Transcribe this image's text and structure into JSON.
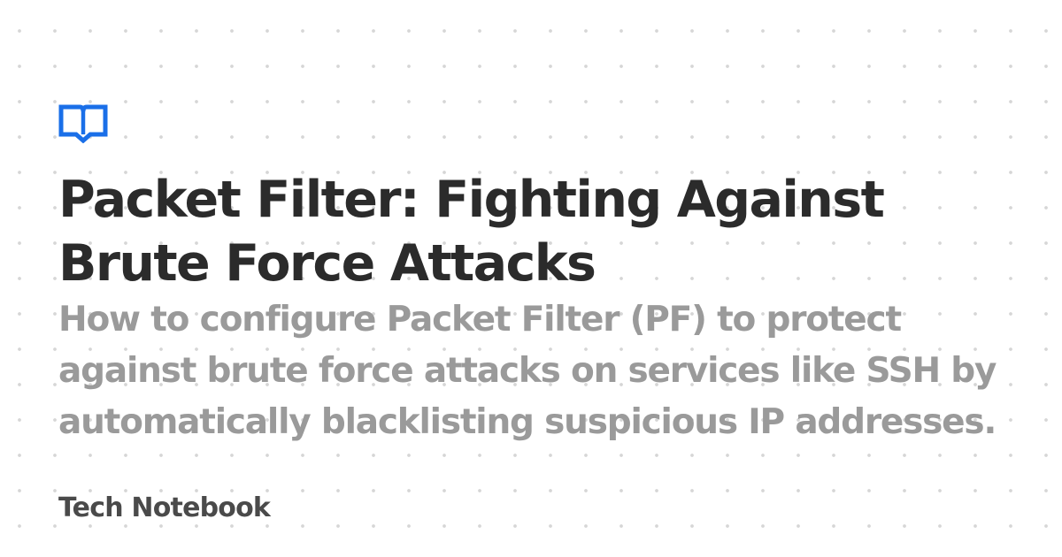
{
  "logo": {
    "icon": "open-book-icon",
    "color": "#1a6fe8"
  },
  "post": {
    "title": "Packet Filter: Fighting Against Brute Force Attacks",
    "description": "How to configure Packet Filter (PF) to protect against brute force attacks on services like SSH by automatically blacklisting suspicious IP addresses."
  },
  "site": {
    "name": "Tech Notebook"
  },
  "colors": {
    "title": "#2b2b2b",
    "description": "#9a9a9a",
    "site_name": "#4a4a4a",
    "background_dots": "#d6d6d6"
  }
}
